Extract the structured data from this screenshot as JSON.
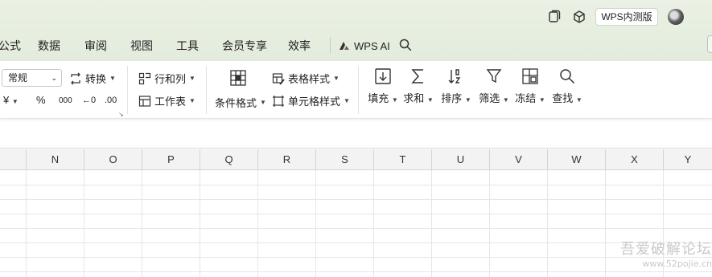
{
  "titlebar": {
    "badge_label": "WPS内测版"
  },
  "menu": {
    "items": [
      "公式",
      "数据",
      "审阅",
      "视图",
      "工具",
      "会员专享",
      "效率"
    ],
    "ai_label": "WPS AI"
  },
  "ribbon": {
    "number_format_value": "常规",
    "convert_label": "转换",
    "currency_glyph": "¥",
    "percent_glyph": "%",
    "thousands_glyph": "000",
    "decrease_decimal_glyph": "←0",
    "increase_decimal_glyph": ".00",
    "rows_cols_label": "行和列",
    "worksheet_label": "工作表",
    "conditional_format_label": "条件格式",
    "table_style_label": "表格样式",
    "cell_style_label": "单元格样式",
    "fill_label": "填充",
    "sum_label": "求和",
    "sort_label": "排序",
    "filter_label": "筛选",
    "freeze_label": "冻结",
    "find_label": "查找"
  },
  "grid": {
    "columns": [
      "N",
      "O",
      "P",
      "Q",
      "R",
      "S",
      "T",
      "U",
      "V",
      "W",
      "X",
      "Y"
    ]
  },
  "watermark": {
    "title": "吾爱破解论坛",
    "url": "www.52pojie.cn"
  }
}
